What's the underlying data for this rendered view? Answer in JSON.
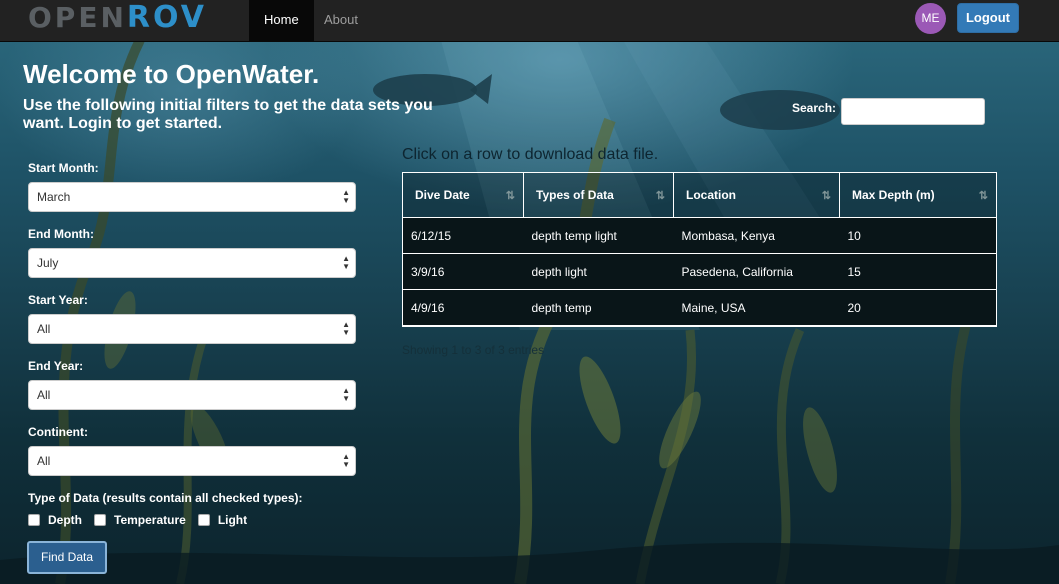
{
  "navbar": {
    "brand_prefix": "OPEN",
    "brand_suffix": "ROV",
    "items": [
      {
        "label": "Home",
        "active": true
      },
      {
        "label": "About",
        "active": false
      }
    ],
    "avatar_initials": "ME",
    "logout_label": "Logout"
  },
  "hero": {
    "title": "Welcome to OpenWater.",
    "subtitle": "Use the following initial filters to get the data sets you want. Login to get started."
  },
  "filters": {
    "start_month": {
      "label": "Start Month:",
      "value": "March"
    },
    "end_month": {
      "label": "End Month:",
      "value": "July"
    },
    "start_year": {
      "label": "Start Year:",
      "value": "All"
    },
    "end_year": {
      "label": "End Year:",
      "value": "All"
    },
    "continent": {
      "label": "Continent:",
      "value": "All"
    },
    "type_label": "Type of Data (results contain all checked types):",
    "types": [
      "Depth",
      "Temperature",
      "Light"
    ],
    "submit_label": "Find Data"
  },
  "search": {
    "label": "Search:",
    "value": ""
  },
  "table": {
    "hint": "Click on a row to download data file.",
    "columns": [
      "Dive Date",
      "Types of Data",
      "Location",
      "Max Depth (m)"
    ],
    "rows": [
      [
        "6/12/15",
        "depth temp light",
        "Mombasa, Kenya",
        "10"
      ],
      [
        "3/9/16",
        "depth light",
        "Pasedena, California",
        "15"
      ],
      [
        "4/9/16",
        "depth temp",
        "Maine, USA",
        "20"
      ]
    ],
    "info": "Showing 1 to 3 of 3 entries"
  },
  "colors": {
    "accent": "#337ab7",
    "navbar": "#222222",
    "avatar": "#9b59b6"
  }
}
